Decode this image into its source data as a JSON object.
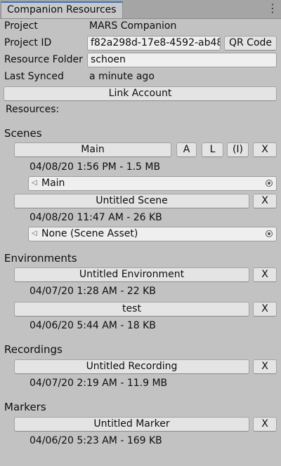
{
  "window": {
    "tab_title": "Companion Resources",
    "menu_icon": "kebab-menu-icon"
  },
  "project": {
    "label": "Project",
    "value": "MARS Companion"
  },
  "project_id": {
    "label": "Project ID",
    "value": "f82a298d-17e8-4592-ab48",
    "qr_button": "QR Code"
  },
  "resource_folder": {
    "label": "Resource Folder",
    "value": "schoen"
  },
  "last_synced": {
    "label": "Last Synced",
    "value": "a minute ago"
  },
  "link_account": "Link Account",
  "resources_label": "Resources:",
  "scenes": {
    "header": "Scenes",
    "items": [
      {
        "name": "Main",
        "meta": "04/08/20 1:56 PM - 1.5 MB",
        "asset": "Main",
        "buttons": [
          "A",
          "L",
          "(I)",
          "X"
        ]
      },
      {
        "name": "Untitled Scene",
        "meta": "04/08/20 11:47 AM - 26 KB",
        "asset": "None (Scene Asset)",
        "remove": "X"
      }
    ]
  },
  "environments": {
    "header": "Environments",
    "items": [
      {
        "name": "Untitled Environment",
        "meta": "04/07/20 1:28 AM - 22 KB",
        "remove": "X"
      },
      {
        "name": "test",
        "meta": "04/06/20 5:44 AM - 18 KB",
        "remove": "X"
      }
    ]
  },
  "recordings": {
    "header": "Recordings",
    "items": [
      {
        "name": "Untitled Recording",
        "meta": "04/07/20 2:19 AM - 11.9 MB",
        "remove": "X"
      }
    ]
  },
  "markers": {
    "header": "Markers",
    "items": [
      {
        "name": "Untitled Marker",
        "meta": "04/06/20 5:23 AM - 169 KB",
        "remove": "X"
      }
    ]
  }
}
